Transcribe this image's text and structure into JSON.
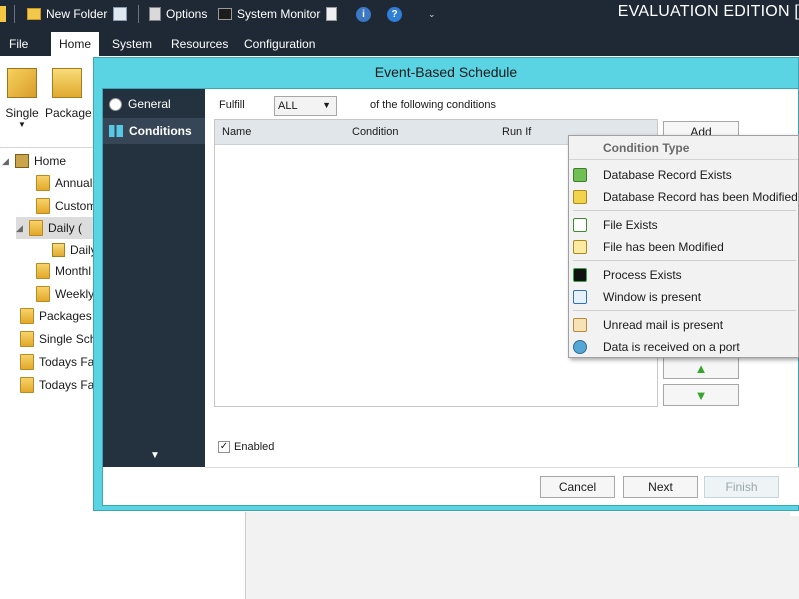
{
  "toolbar": {
    "new_folder": "New Folder",
    "options": "Options",
    "system_monitor": "System Monitor",
    "edition": "EVALUATION EDITION ["
  },
  "ribbon_tabs": [
    "File",
    "Home",
    "System",
    "Resources",
    "Configuration"
  ],
  "ribbon": {
    "single": "Single",
    "package": "Package"
  },
  "tree": {
    "items": [
      "Home",
      "Annual",
      "Custom",
      "Daily (",
      "Daily",
      "Monthl",
      "Weekly",
      "Packages",
      "Single Sch",
      "Todays Fa",
      "Todays Fa"
    ]
  },
  "dialog": {
    "title": "Event-Based Schedule",
    "nav": [
      "General",
      "Conditions"
    ],
    "fulfill_label": "Fulfill",
    "fulfill_value": "ALL",
    "conditions_text": "of the following conditions",
    "columns": [
      "Name",
      "Condition",
      "Run If"
    ],
    "add_label": "Add",
    "enabled_label": "Enabled",
    "buttons": {
      "cancel": "Cancel",
      "next": "Next",
      "finish": "Finish"
    }
  },
  "menu": {
    "header": "Condition Type",
    "items": [
      "Database Record Exists",
      "Database Record has been Modified",
      "File Exists",
      "File has been Modified",
      "Process Exists",
      "Window is present",
      "Unread mail is present",
      "Data is received on a port"
    ]
  },
  "colors": {
    "dialog_frame": "#5ad3e3",
    "nav_bg": "#24313f",
    "titlebar_bg": "#1f2935"
  }
}
